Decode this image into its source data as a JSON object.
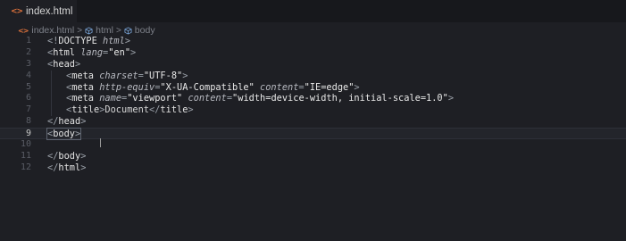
{
  "tab": {
    "icon": "html-file-icon",
    "icon_glyph": "<>",
    "label": "index.html",
    "unsaved": true
  },
  "breadcrumb": {
    "file": "index.html",
    "items": [
      "html",
      "body"
    ],
    "separator": ">"
  },
  "editor": {
    "current_line": 9,
    "lines": [
      {
        "n": "1",
        "text": "<!DOCTYPE html>"
      },
      {
        "n": "2",
        "text": "<html lang=\"en\">"
      },
      {
        "n": "3",
        "text": "<head>"
      },
      {
        "n": "4",
        "text": "<meta charset=\"UTF-8\">"
      },
      {
        "n": "5",
        "text": "<meta http-equiv=\"X-UA-Compatible\" content=\"IE=edge\">"
      },
      {
        "n": "6",
        "text": "<meta name=\"viewport\" content=\"width=device-width, initial-scale=1.0\">"
      },
      {
        "n": "7",
        "text": "<title>Document</title>"
      },
      {
        "n": "8",
        "text": "</head>"
      },
      {
        "n": "9",
        "text": "<body>"
      },
      {
        "n": "10",
        "text": ""
      },
      {
        "n": "11",
        "text": "</body>"
      },
      {
        "n": "12",
        "text": "</html>"
      }
    ]
  },
  "colors": {
    "background": "#1e1f24",
    "tabbar": "#17181c",
    "html_icon": "#e0733c",
    "line_numbers": "#5a5d66",
    "text": "#d4d4d4"
  }
}
